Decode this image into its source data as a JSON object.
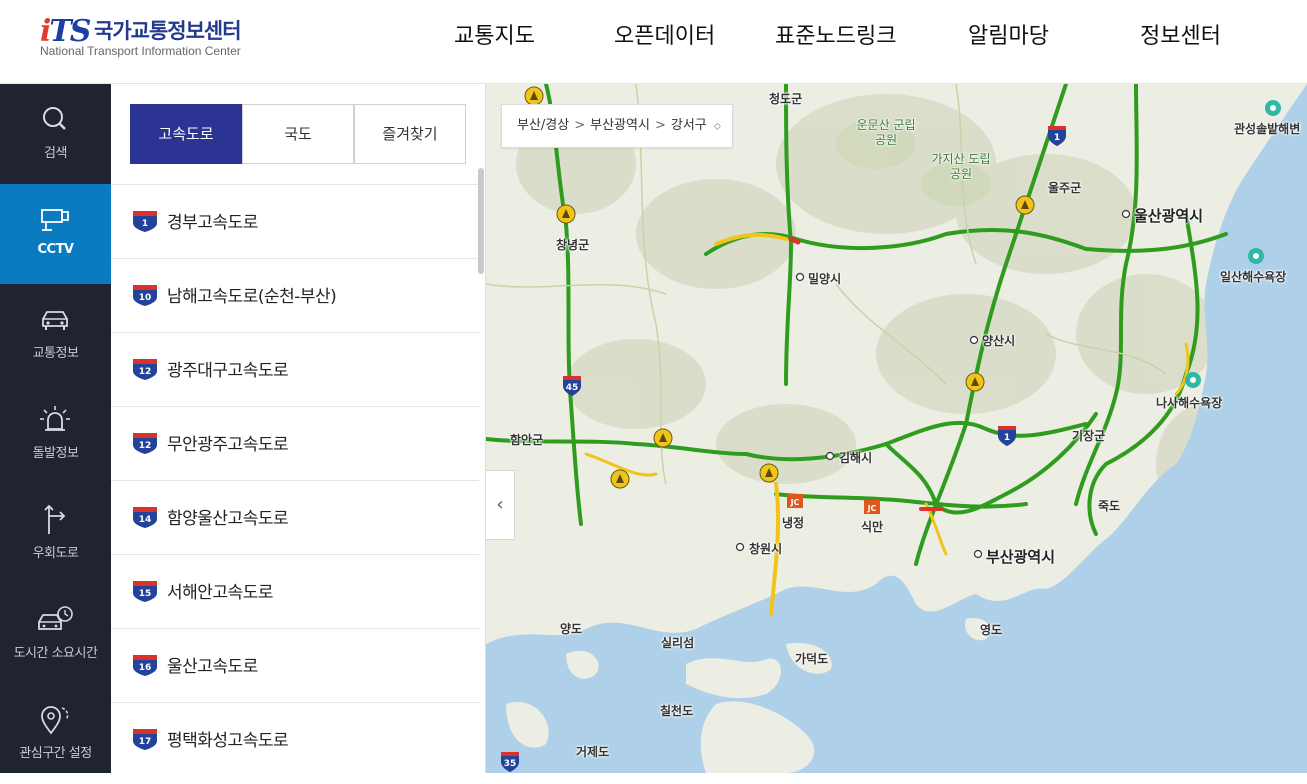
{
  "header": {
    "logo_mark": "iTS",
    "logo_kr": "국가교통정보센터",
    "logo_en": "National Transport Information Center",
    "nav": [
      "교통지도",
      "오픈데이터",
      "표준노드링크",
      "알림마당",
      "정보센터"
    ]
  },
  "sidebar": {
    "items": [
      {
        "label": "검색",
        "icon": "search-icon"
      },
      {
        "label": "CCTV",
        "icon": "cctv-icon",
        "active": true
      },
      {
        "label": "교통정보",
        "icon": "car-icon"
      },
      {
        "label": "돌발정보",
        "icon": "alert-light-icon"
      },
      {
        "label": "우회도로",
        "icon": "detour-arrow-icon"
      },
      {
        "label": "도시간 소요시간",
        "icon": "car-clock-icon"
      },
      {
        "label": "관심구간 설정",
        "icon": "location-pin-icon"
      }
    ]
  },
  "panel": {
    "tabs": [
      "고속도로",
      "국도",
      "즐겨찾기"
    ],
    "active_tab": "고속도로",
    "highways": [
      {
        "number": "1",
        "name": "경부고속도로"
      },
      {
        "number": "10",
        "name": "남해고속도로(순천-부산)"
      },
      {
        "number": "12",
        "name": "광주대구고속도로"
      },
      {
        "number": "12",
        "name": "무안광주고속도로"
      },
      {
        "number": "14",
        "name": "함양울산고속도로"
      },
      {
        "number": "15",
        "name": "서해안고속도로"
      },
      {
        "number": "16",
        "name": "울산고속도로"
      },
      {
        "number": "17",
        "name": "평택화성고속도로"
      }
    ]
  },
  "map": {
    "breadcrumb": [
      "부산/경상",
      "부산광역시",
      "강서구"
    ],
    "breadcrumb_sep": ">",
    "breadcrumb_caret": "⬦",
    "collapse_glyph": "‹",
    "labels": [
      "청도군",
      "운문산 군립공원",
      "가지산 도립공원",
      "울주군",
      "울산광역시",
      "관성솔밭해변",
      "창녕군",
      "밀양시",
      "양산시",
      "일산해수욕장",
      "나사해수욕장",
      "함안군",
      "김해시",
      "기장군",
      "냉정",
      "식만",
      "창원시",
      "부산광역시",
      "죽도",
      "양도",
      "실리섬",
      "가덕도",
      "영도",
      "칠천도",
      "거제도"
    ],
    "route_shields": [
      "1",
      "1",
      "45",
      "35"
    ],
    "colors": {
      "sea": "#aed0e8",
      "land": "#eceee2",
      "mountain": "#d9ddc6",
      "road_smooth": "#2f9c1f",
      "road_slow": "#f0c419",
      "road_jam": "#e0342a",
      "shield_blue": "#23439a",
      "shield_red": "#d8322b"
    }
  }
}
